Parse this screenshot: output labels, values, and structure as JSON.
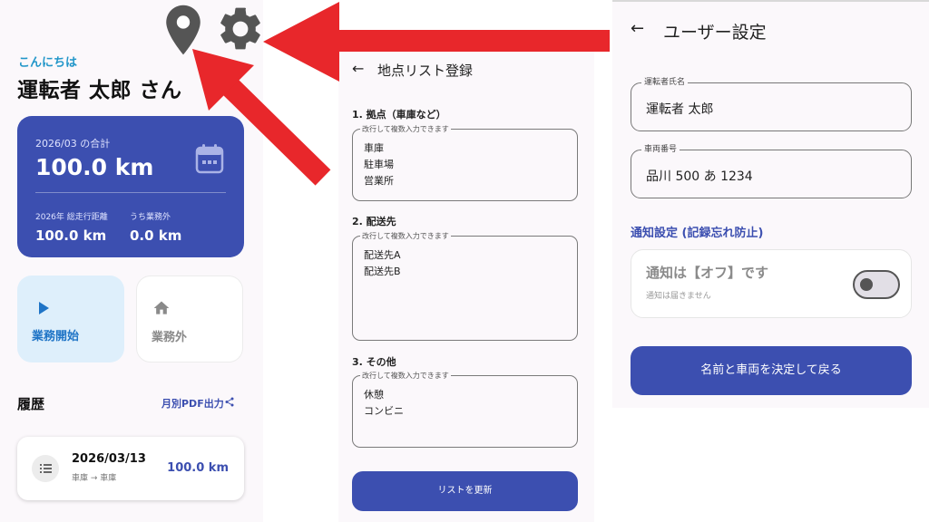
{
  "home": {
    "greeting": "こんにちは",
    "user_name": "運転者 太郎 さん",
    "top_icons": [
      "map-pin-icon",
      "gear-icon"
    ],
    "summary": {
      "month_label": "2026/03 の合計",
      "month_value": "100.0 km",
      "year_label": "2026年 総走行距離",
      "year_value": "100.0 km",
      "off_label": "うち業務外",
      "off_value": "0.0 km",
      "icon": "calendar-icon"
    },
    "start_button": "業務開始",
    "off_button": "業務外",
    "history": {
      "title": "履歴",
      "pdf_link": "月別PDF出力",
      "items": [
        {
          "date": "2026/03/13",
          "route": "車庫 → 車庫",
          "distance": "100.0 km"
        }
      ]
    }
  },
  "locations": {
    "title": "地点リスト登録",
    "hint": "改行して複数入力できます",
    "sections": [
      {
        "heading": "1. 拠点（車庫など）",
        "lines": [
          "車庫",
          "駐車場",
          "営業所"
        ]
      },
      {
        "heading": "2. 配送先",
        "lines": [
          "配送先A",
          "配送先B"
        ]
      },
      {
        "heading": "3. その他",
        "lines": [
          "休憩",
          "コンビニ"
        ]
      }
    ],
    "update_button": "リストを更新"
  },
  "settings": {
    "title": "ユーザー設定",
    "driver_label": "運転者氏名",
    "driver_value": "運転者 太郎",
    "vehicle_label": "車両番号",
    "vehicle_value": "品川 500 あ 1234",
    "notification_heading": "通知設定 (記録忘れ防止)",
    "notification_title": "通知は【オフ】です",
    "notification_sub": "通知は届きません",
    "notification_on": false,
    "confirm_button": "名前と車両を決定して戻る"
  },
  "colors": {
    "primary": "#3c4fb0",
    "accent_blue": "#2196c9",
    "start_bg": "#deeffb",
    "arrow_red": "#e8272b"
  }
}
